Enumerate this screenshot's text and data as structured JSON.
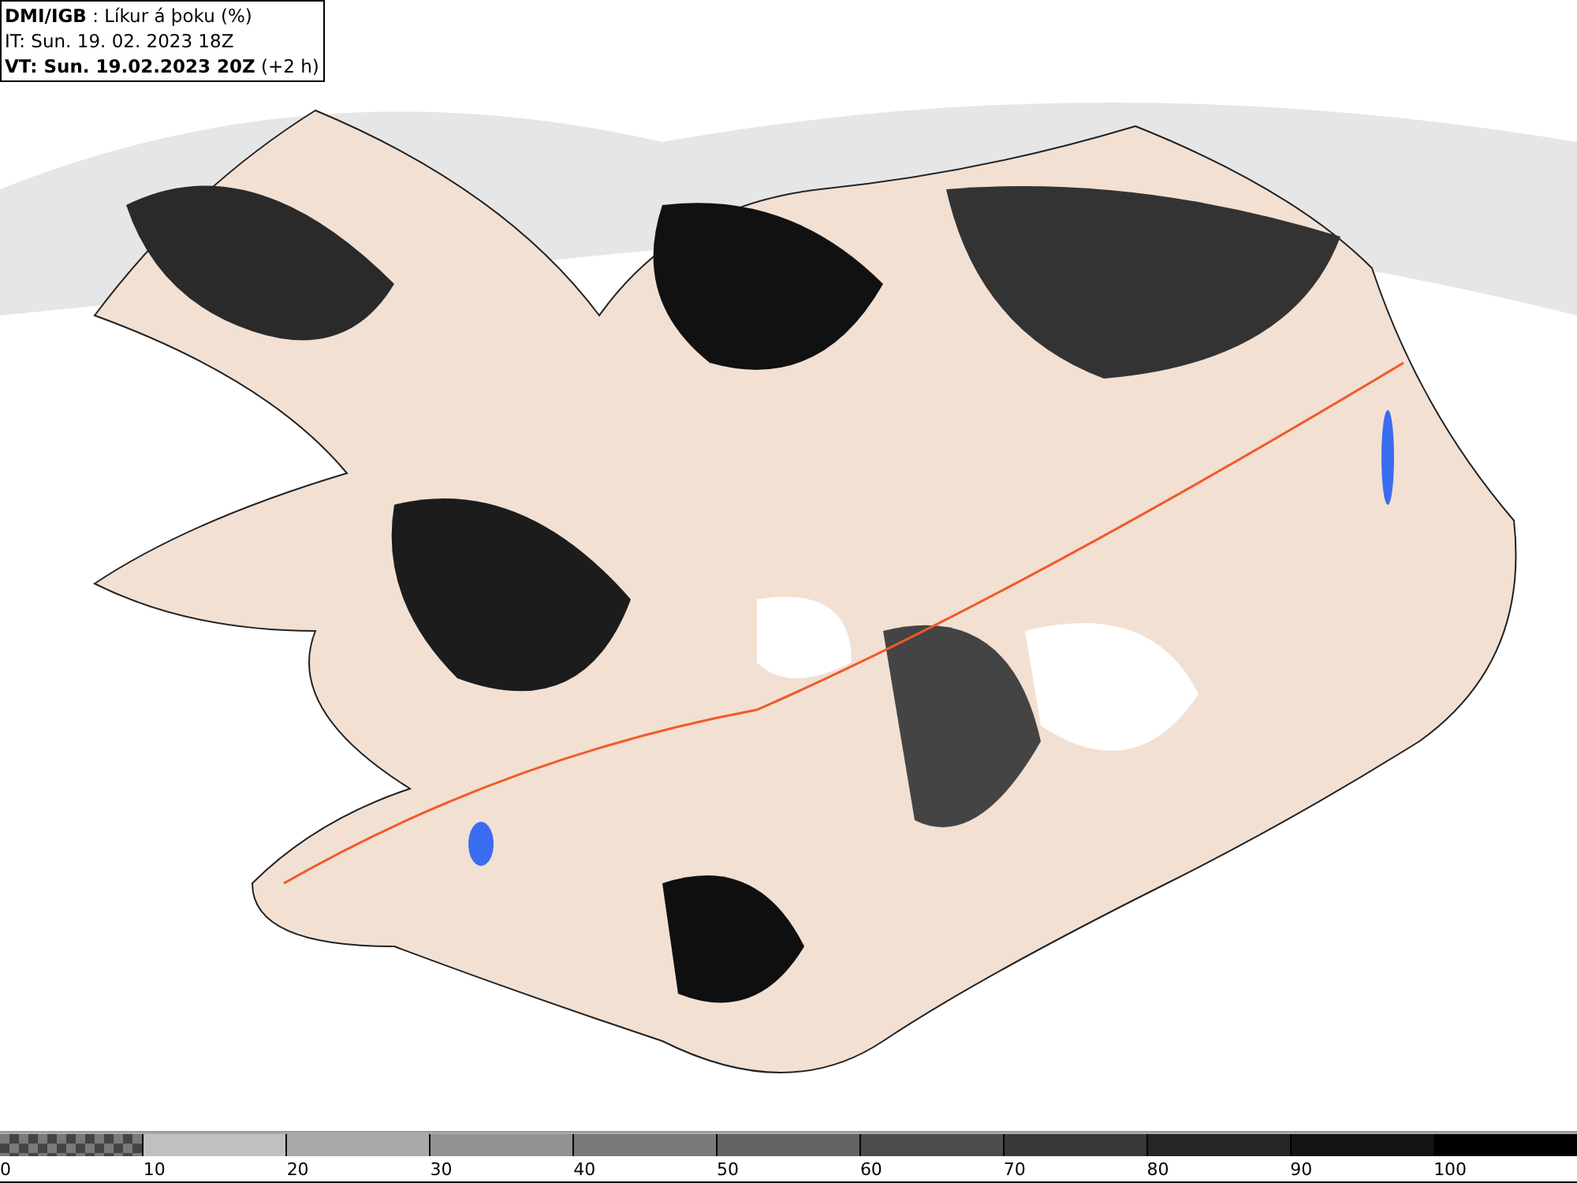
{
  "header": {
    "lines": [
      "**DMI/IGB** : Líkur á þoku (%)",
      "IT: Sun. 19. 02. 2023 18Z",
      "**VT: Sun. 19.02.2023 20Z** (+2 h)"
    ]
  },
  "legend": [
    {
      "label": "0",
      "kind": "checker",
      "color": "#7a7a7a"
    },
    {
      "label": "10",
      "kind": "solid",
      "color": "#c0c0c0"
    },
    {
      "label": "20",
      "kind": "solid",
      "color": "#a9a9a9"
    },
    {
      "label": "30",
      "kind": "solid",
      "color": "#929292"
    },
    {
      "label": "40",
      "kind": "solid",
      "color": "#7a7a7a"
    },
    {
      "label": "50",
      "kind": "solid",
      "color": "#636363"
    },
    {
      "label": "60",
      "kind": "solid",
      "color": "#4c4c4c"
    },
    {
      "label": "70",
      "kind": "solid",
      "color": "#383838"
    },
    {
      "label": "80",
      "kind": "solid",
      "color": "#262626"
    },
    {
      "label": "90",
      "kind": "solid",
      "color": "#141414"
    },
    {
      "label": "100",
      "kind": "solid",
      "color": "#000000"
    }
  ]
}
